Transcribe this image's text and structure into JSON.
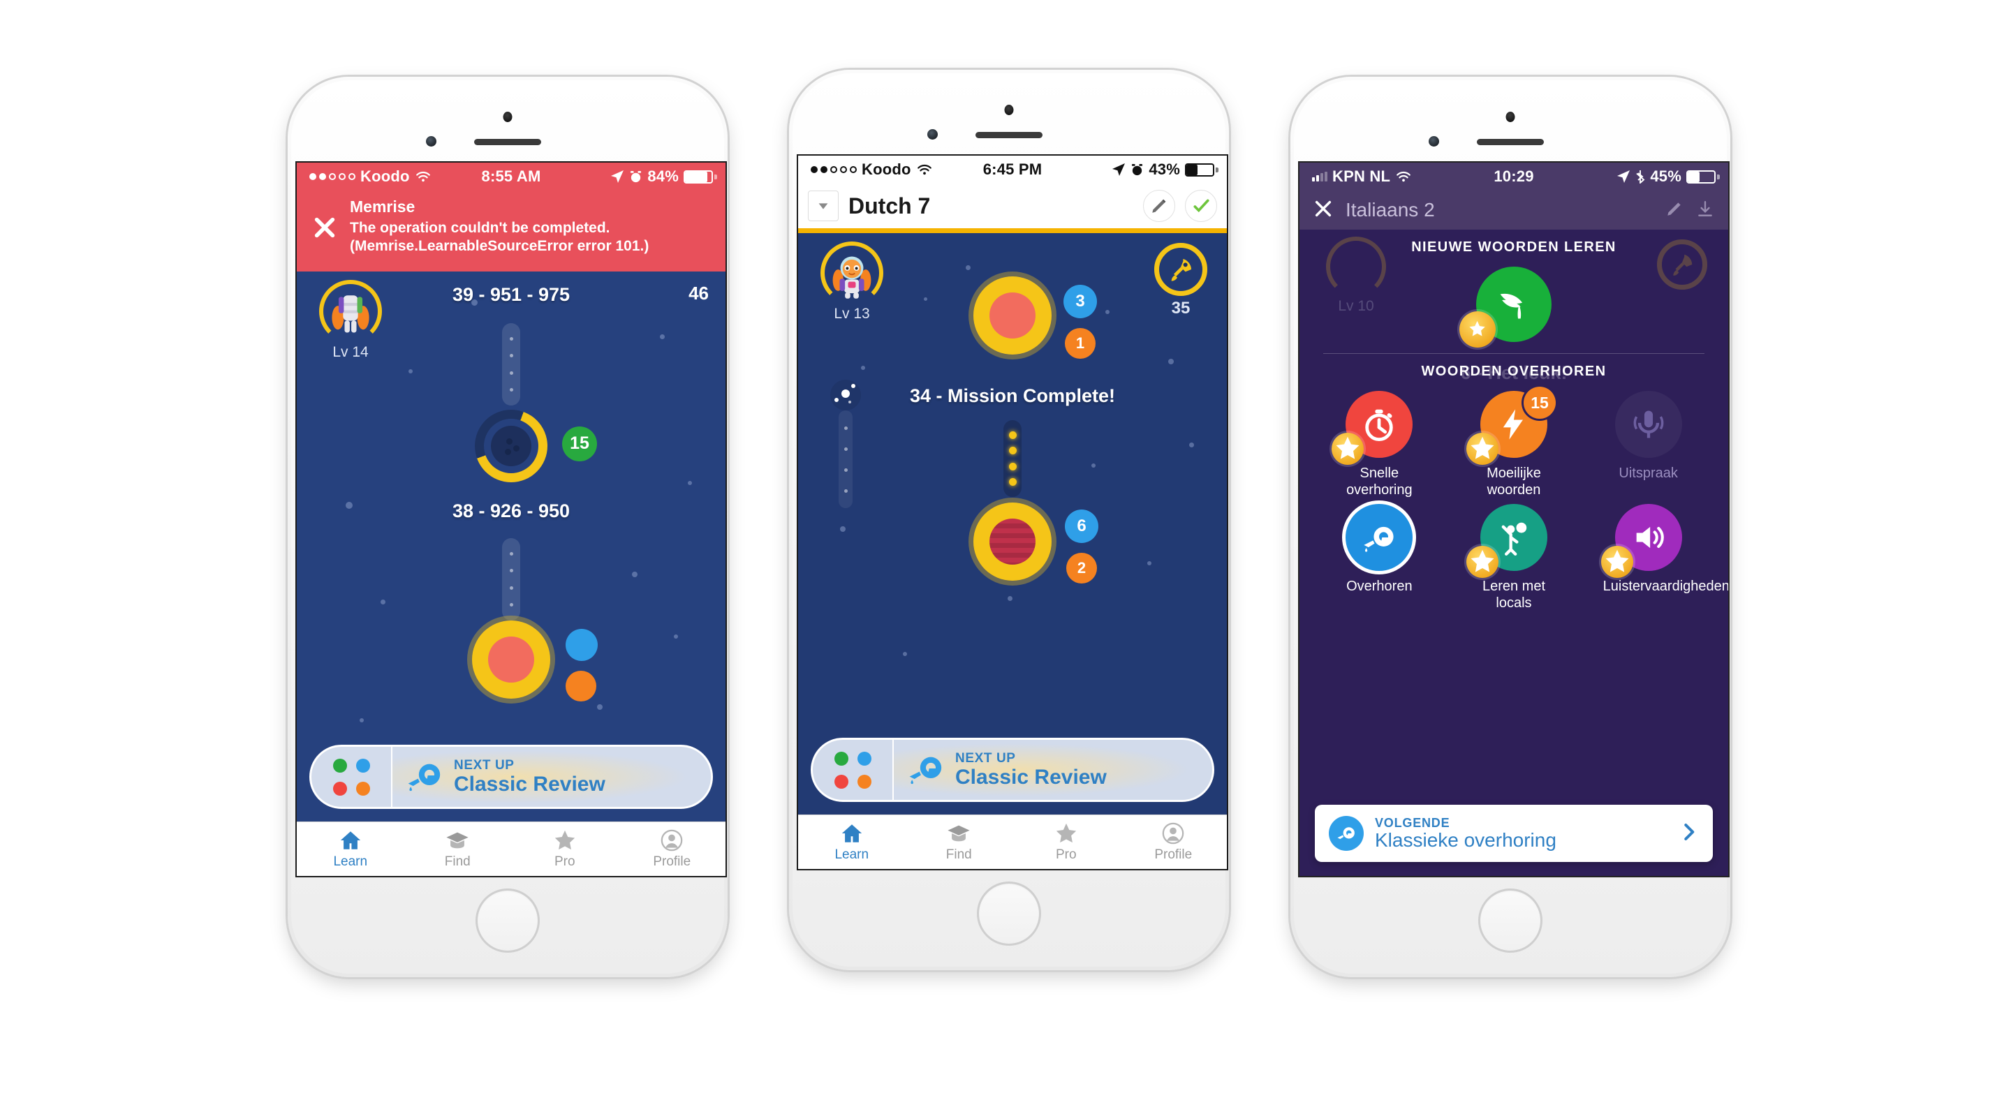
{
  "phones": [
    {
      "id": "phone-1",
      "status": {
        "carrier": "Koodo",
        "time": "8:55 AM",
        "battery": "84%",
        "signal_dots": [
          1,
          1,
          0,
          0,
          0
        ]
      },
      "error": {
        "title": "Memrise",
        "message": "The operation couldn't be completed. (Memrise.LearnableSourceError error 101.)",
        "close_icon": "close-icon"
      },
      "avatar": {
        "level_label": "Lv 14"
      },
      "corner_count": "46",
      "path": {
        "upper_title": "39 - 951 - 975",
        "lower_title": "38 - 926 - 950",
        "node_badge": "15"
      },
      "nextup": {
        "kicker": "NEXT UP",
        "title": "Classic Review",
        "icon": "watering-can-icon"
      },
      "tabs": [
        {
          "label": "Learn",
          "icon": "home-icon",
          "active": true
        },
        {
          "label": "Find",
          "icon": "graduation-cap-icon",
          "active": false
        },
        {
          "label": "Pro",
          "icon": "star-icon",
          "active": false
        },
        {
          "label": "Profile",
          "icon": "person-icon",
          "active": false
        }
      ]
    },
    {
      "id": "phone-2",
      "status": {
        "carrier": "Koodo",
        "time": "6:45 PM",
        "battery": "43%",
        "signal_dots": [
          1,
          1,
          0,
          0,
          0
        ]
      },
      "header": {
        "title": "Dutch 7",
        "dropdown_icon": "chevron-down-icon",
        "edit_icon": "pencil-icon",
        "check_icon": "check-icon"
      },
      "avatar": {
        "level_label": "Lv 13"
      },
      "rocket": {
        "count": "35",
        "icon": "rocket-icon"
      },
      "path": {
        "mission_title": "34 - Mission Complete!",
        "upper_badges": [
          {
            "value": "3",
            "color": "blue"
          },
          {
            "value": "1",
            "color": "orange"
          }
        ],
        "lower_badges": [
          {
            "value": "6",
            "color": "blue"
          },
          {
            "value": "2",
            "color": "orange"
          }
        ]
      },
      "nextup": {
        "kicker": "NEXT UP",
        "title": "Classic Review",
        "icon": "watering-can-icon"
      },
      "tabs": [
        {
          "label": "Learn",
          "icon": "home-icon",
          "active": true
        },
        {
          "label": "Find",
          "icon": "graduation-cap-icon",
          "active": false
        },
        {
          "label": "Pro",
          "icon": "star-icon",
          "active": false
        },
        {
          "label": "Profile",
          "icon": "person-icon",
          "active": false
        }
      ]
    },
    {
      "id": "phone-3",
      "status": {
        "carrier": "KPN NL",
        "time": "10:29",
        "battery": "45%"
      },
      "header": {
        "title": "Italiaans 2",
        "close_icon": "close-icon",
        "edit_icon": "pencil-icon",
        "download_icon": "download-icon"
      },
      "background": {
        "level_label": "Lv 10",
        "level_title": "6 - Het leuk!"
      },
      "section_learn": {
        "label": "NIEUWE WOORDEN LEREN",
        "icon": "planting-hand-icon",
        "coin_icon": "star-coin-icon"
      },
      "section_review": {
        "label": "WOORDEN OVERHOREN",
        "items": [
          {
            "label": "Snelle overhoring",
            "icon": "stopwatch-icon",
            "color": "#f0453e",
            "coin": true,
            "badge": null,
            "dim": false,
            "ringed": false
          },
          {
            "label": "Moeilijke woorden",
            "icon": "lightning-icon",
            "color": "#f58220",
            "coin": true,
            "badge": "15",
            "dim": false,
            "ringed": false
          },
          {
            "label": "Uitspraak",
            "icon": "microphone-icon",
            "color": "ghost",
            "coin": false,
            "badge": null,
            "dim": true,
            "ringed": false
          },
          {
            "label": "Overhoren",
            "icon": "watering-can-icon",
            "color": "#1f90e0",
            "coin": false,
            "badge": null,
            "dim": false,
            "ringed": true
          },
          {
            "label": "Leren met locals",
            "icon": "person-wave-icon",
            "color": "#16a085",
            "coin": true,
            "badge": null,
            "dim": false,
            "ringed": false
          },
          {
            "label": "Luistervaardigheden",
            "icon": "speaker-icon",
            "color": "#a02bbd",
            "coin": true,
            "badge": null,
            "dim": false,
            "ringed": false
          }
        ]
      },
      "cta": {
        "kicker": "VOLGENDE",
        "title": "Klassieke overhoring",
        "icon": "watering-can-icon",
        "chevron": "chevron-right-icon"
      }
    }
  ],
  "colors": {
    "error_red": "#e8505b",
    "space_blue": "#26417e",
    "accent_blue": "#2f80c4",
    "gold": "#f5c518",
    "purple_bg": "#2e1f58"
  }
}
